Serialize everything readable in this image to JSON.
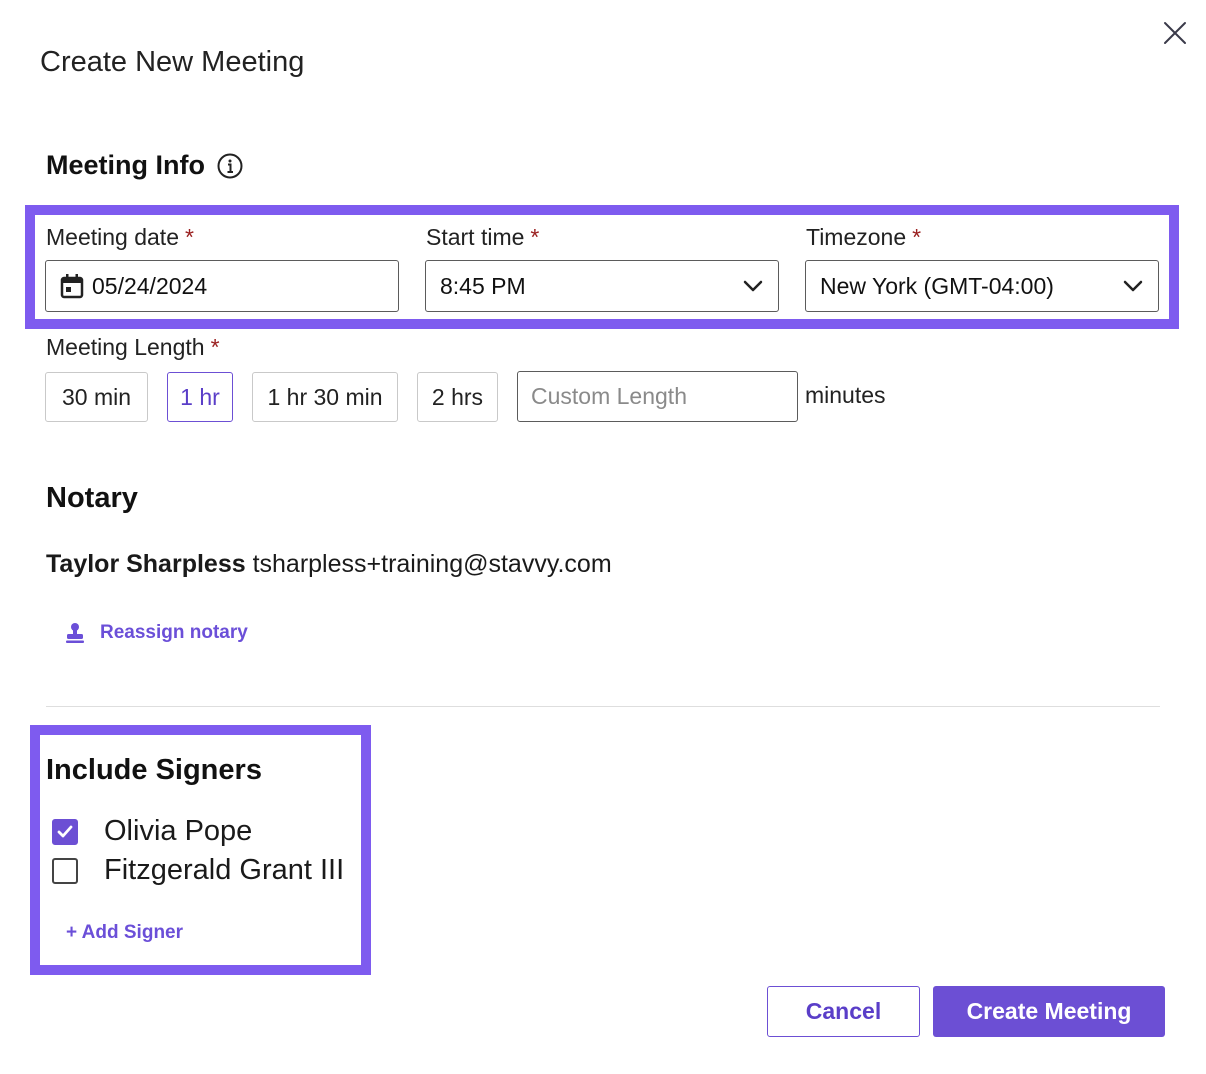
{
  "dialog": {
    "title": "Create New Meeting"
  },
  "meeting_info": {
    "heading": "Meeting Info",
    "required_mark": "*",
    "date": {
      "label": "Meeting date",
      "value": "05/24/2024"
    },
    "start_time": {
      "label": "Start time",
      "value": "8:45 PM"
    },
    "timezone": {
      "label": "Timezone",
      "value": "New York (GMT-04:00)"
    },
    "length": {
      "label": "Meeting Length",
      "options": [
        "30 min",
        "1 hr",
        "1 hr 30 min",
        "2 hrs"
      ],
      "selected": "1 hr",
      "custom_placeholder": "Custom Length",
      "unit": "minutes"
    }
  },
  "notary": {
    "heading": "Notary",
    "name": "Taylor Sharpless",
    "email": "tsharpless+training@stavvy.com",
    "reassign_label": "Reassign notary"
  },
  "signers": {
    "heading": "Include Signers",
    "items": [
      {
        "name": "Olivia Pope",
        "checked": true
      },
      {
        "name": "Fitzgerald Grant III",
        "checked": false
      }
    ],
    "add_label": "+ Add Signer"
  },
  "actions": {
    "cancel_label": "Cancel",
    "create_label": "Create Meeting"
  },
  "colors": {
    "accent": "#6c4fd4",
    "highlight": "#7e5bef",
    "required": "#9a2020"
  }
}
